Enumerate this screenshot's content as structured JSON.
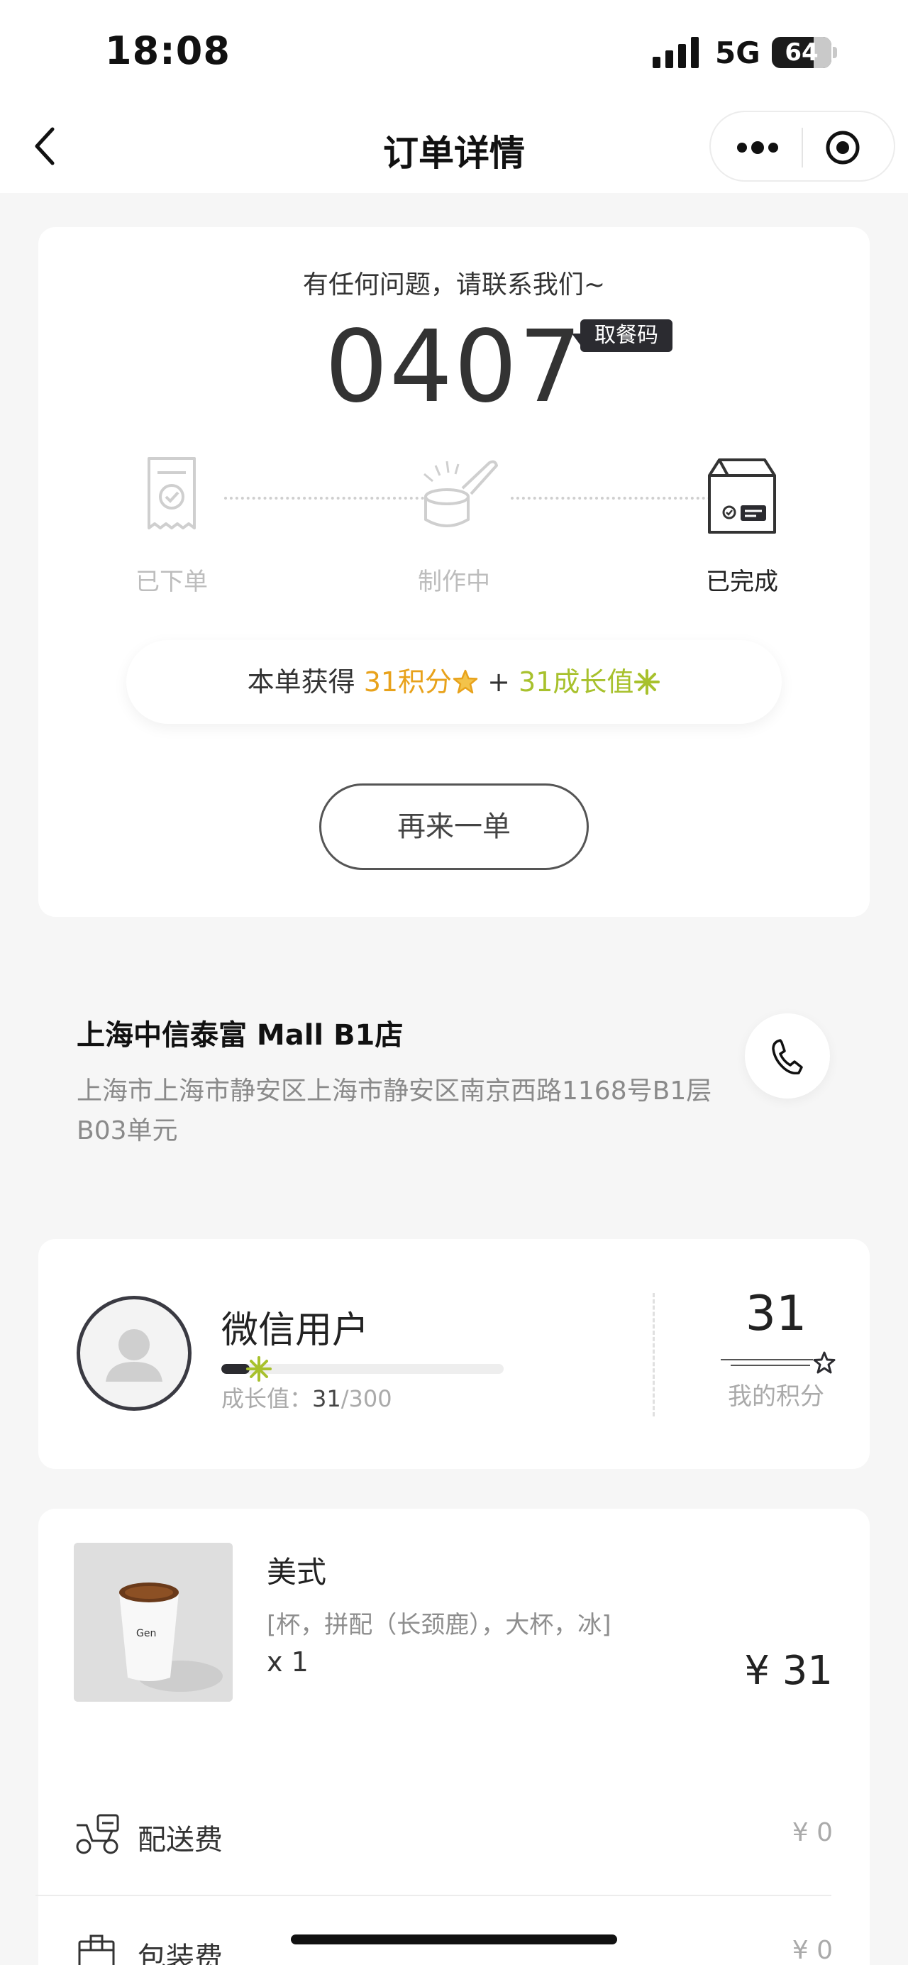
{
  "status_bar": {
    "time": "18:08",
    "network": "5G",
    "battery": "64"
  },
  "nav": {
    "title": "订单详情"
  },
  "order": {
    "hint": "有任何问题，请联系我们~",
    "pickup_code": "0407",
    "pickup_badge": "取餐码",
    "steps": [
      {
        "label": "已下单",
        "state": "done"
      },
      {
        "label": "制作中",
        "state": "done"
      },
      {
        "label": "已完成",
        "state": "current"
      }
    ],
    "reward": {
      "prefix": "本单获得 ",
      "points": "31积分",
      "plus": " + ",
      "growth": "31成长值"
    },
    "reorder_label": "再来一单"
  },
  "store": {
    "name": "上海中信泰富 Mall B1店",
    "address": "上海市上海市静安区上海市静安区南京西路1168号B1层B03单元"
  },
  "member": {
    "name": "微信用户",
    "growth_label": "成长值：",
    "growth_current": "31",
    "growth_max": "/300",
    "growth_progress": 0.1,
    "points": "31",
    "points_label": "我的积分"
  },
  "items": [
    {
      "name": "美式",
      "spec": "[杯，拼配（长颈鹿），大杯，冰]",
      "qty": "x 1",
      "price": "¥ 31"
    }
  ],
  "fees": [
    {
      "label": "配送费",
      "value": "¥ 0",
      "icon": "scooter-icon"
    },
    {
      "label": "包装费",
      "value": "¥ 0",
      "icon": "package-icon"
    }
  ],
  "colors": {
    "accent_orange": "#e8a21b",
    "accent_green": "#a8c12d",
    "dark": "#2b2b30"
  }
}
